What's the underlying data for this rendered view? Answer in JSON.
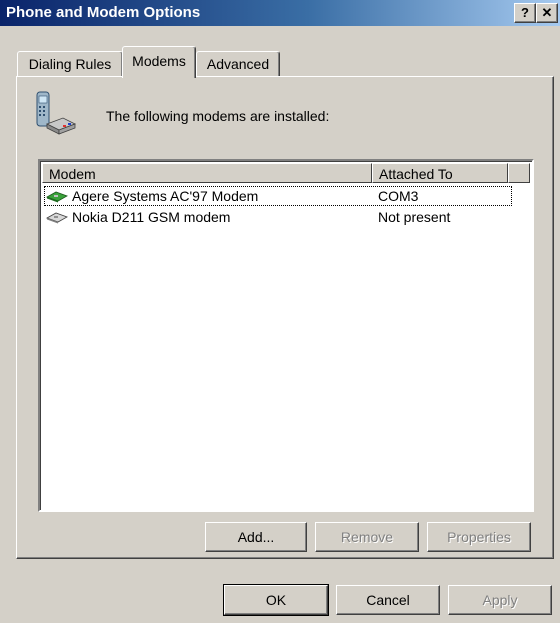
{
  "window": {
    "title": "Phone and Modem Options",
    "help_label": "?",
    "close_label": "✕"
  },
  "tabs": [
    {
      "label": "Dialing Rules",
      "active": false
    },
    {
      "label": "Modems",
      "active": true
    },
    {
      "label": "Advanced",
      "active": false
    }
  ],
  "main": {
    "intro_text": "The following modems are  installed:",
    "icon": "phone-modem-icon"
  },
  "modem_list": {
    "columns": [
      "Modem",
      "Attached To"
    ],
    "rows": [
      {
        "name": "Agere Systems AC'97 Modem",
        "attached": "COM3",
        "icon": "modem-icon",
        "selected": true
      },
      {
        "name": "Nokia D211 GSM modem",
        "attached": "Not present",
        "icon": "modem-icon",
        "selected": false
      }
    ]
  },
  "buttons": {
    "add": "Add...",
    "remove": "Remove",
    "properties": "Properties",
    "ok": "OK",
    "cancel": "Cancel",
    "apply": "Apply"
  },
  "colors": {
    "face": "#d4d0c8",
    "title_start": "#0a246a",
    "title_end": "#a6caf0"
  }
}
